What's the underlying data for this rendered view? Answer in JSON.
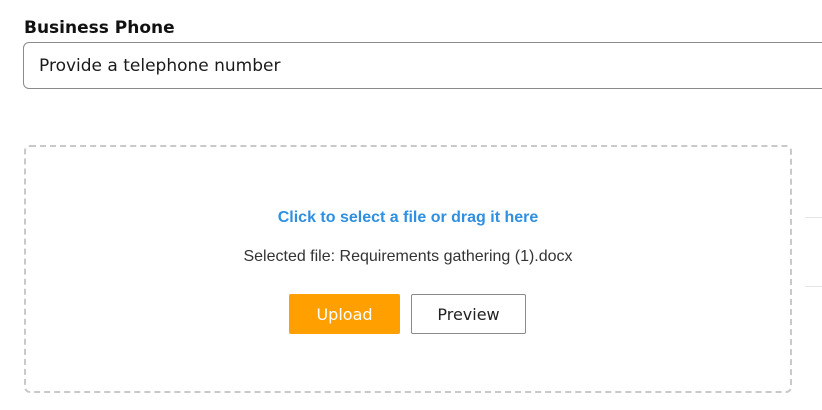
{
  "form": {
    "business_phone": {
      "label": "Business Phone",
      "value": "Provide a telephone number"
    }
  },
  "uploader": {
    "prompt": "Click to select a file or drag it here",
    "selected_file": "Selected file: Requirements gathering (1).docx",
    "upload_label": "Upload",
    "preview_label": "Preview"
  },
  "colors": {
    "accent_orange": "#ff9f00",
    "link_blue": "#2f8fe0",
    "border_gray": "#8a8a8a",
    "dash_gray": "#c9c9c9"
  }
}
